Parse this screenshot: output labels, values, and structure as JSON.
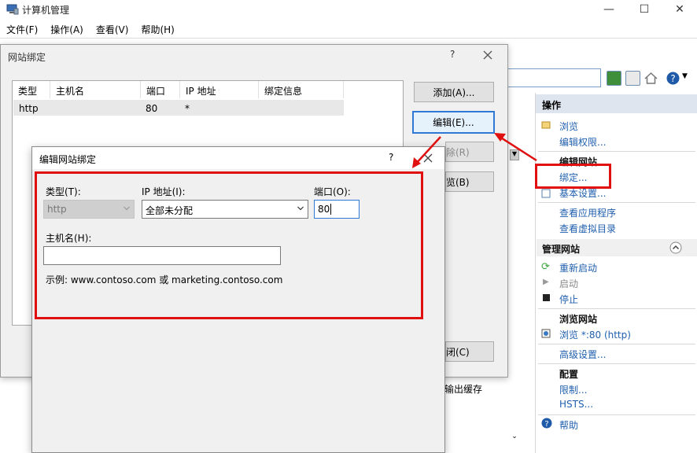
{
  "app": {
    "title": "计算机管理"
  },
  "window_controls": {
    "minimize": "—",
    "maximize": "☐",
    "close": "✕"
  },
  "menu": [
    "文件(F)",
    "操作(A)",
    "查看(V)",
    "帮助(H)"
  ],
  "actions_pane": {
    "header": "操作",
    "browse": "浏览",
    "edit_permissions": "编辑权限...",
    "edit_site_head": "编辑网站",
    "bindings": "绑定...",
    "basic_settings": "基本设置...",
    "view_apps": "查看应用程序",
    "view_vdirs": "查看虚拟目录",
    "manage_site_head": "管理网站",
    "restart": "重新启动",
    "start": "启动",
    "stop": "停止",
    "browse_site_head": "浏览网站",
    "browse_80": "浏览 *:80 (http)",
    "advanced_settings": "高级设置...",
    "config_head": "配置",
    "limits": "限制...",
    "hsts": "HSTS...",
    "help": "帮助"
  },
  "background_text": {
    "output_cache": "输出缓存"
  },
  "site_bindings_dialog": {
    "title": "网站绑定",
    "help_glyph": "?",
    "columns": [
      "类型",
      "主机名",
      "端口",
      "IP 地址",
      "绑定信息"
    ],
    "rows": [
      {
        "type": "http",
        "host": "",
        "port": "80",
        "ip": "*",
        "info": ""
      }
    ],
    "add_button": "添加(A)...",
    "edit_button": "编辑(E)...",
    "remove_button_partial": "除(R)",
    "browse_button_partial": "览(B)",
    "close_button_partial": "闭(C)"
  },
  "edit_binding_dialog": {
    "title": "编辑网站绑定",
    "help_glyph": "?",
    "type_label": "类型(T):",
    "type_value": "http",
    "ip_label": "IP 地址(I):",
    "ip_value": "全部未分配",
    "port_label": "端口(O):",
    "port_value": "80",
    "hostname_label": "主机名(H):",
    "hostname_value": "",
    "example": "示例: www.contoso.com 或 marketing.contoso.com"
  },
  "colors": {
    "annotation_red": "#e01010",
    "link_blue": "#1f5fae",
    "focus_blue": "#2f78d4"
  }
}
